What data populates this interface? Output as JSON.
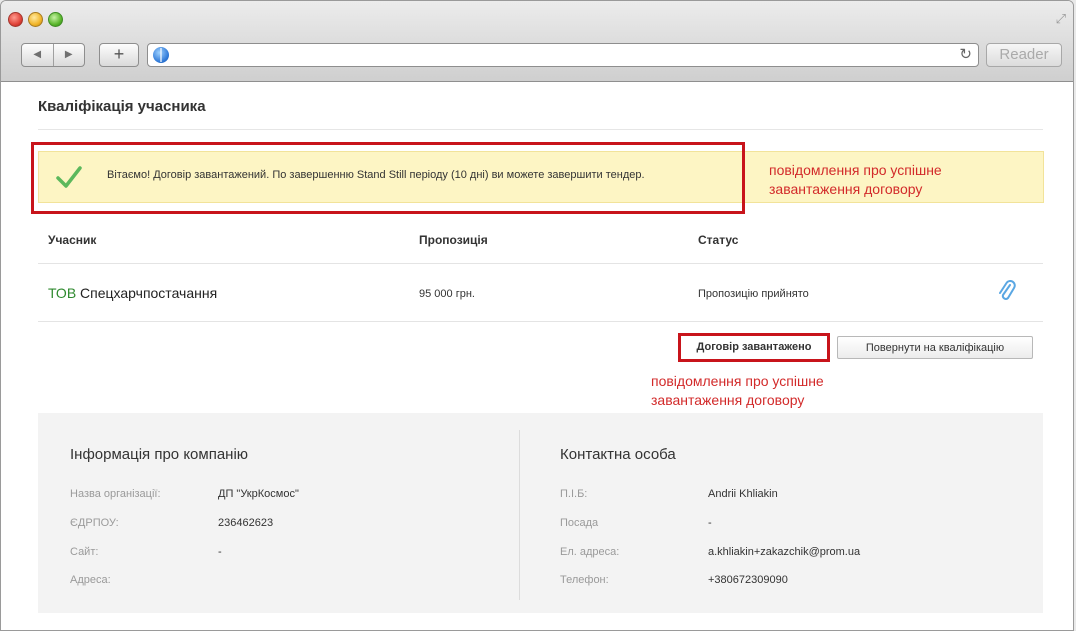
{
  "browser": {
    "reader_label": "Reader",
    "back_glyph": "◀",
    "forward_glyph": "▶",
    "new_tab_glyph": "+",
    "reload_glyph": "↻",
    "resize_glyph": "⤢"
  },
  "page": {
    "title": "Кваліфікація учасника"
  },
  "alert": {
    "text": "Вітаємо! Договір завантажений. По завершенню Stand Still періоду (10 дні) ви можете завершити тендер.",
    "note": "повідомлення про успішне завантаження договору",
    "accent_color": "#5cb85c"
  },
  "table": {
    "headers": [
      "Учасник",
      "Пропозиція",
      "Статус"
    ],
    "row": {
      "prefix": "ТОВ",
      "company": "Спецхарчпостачання",
      "offer": "95 000 грн.",
      "status": "Пропозицію прийнято"
    }
  },
  "actions": {
    "loaded_label": "Договір завантажено",
    "return_label": "Повернути на кваліфікацію",
    "note": "повідомлення про успішне завантаження договору",
    "highlight_color": "#c8141b"
  },
  "company_info": {
    "title": "Інформація про компанію",
    "fields": [
      {
        "label": "Назва організації:",
        "value": "ДП \"УкрКосмос\""
      },
      {
        "label": "ЄДРПОУ:",
        "value": "236462623"
      },
      {
        "label": "Сайт:",
        "value": "-"
      },
      {
        "label": "Адреса:",
        "value": ""
      }
    ]
  },
  "contact": {
    "title": "Контактна особа",
    "fields": [
      {
        "label": "П.І.Б:",
        "value": "Andrii Khliakin"
      },
      {
        "label": "Посада",
        "value": "-"
      },
      {
        "label": "Ел. адреса:",
        "value": "a.khliakin+zakazchik@prom.ua"
      },
      {
        "label": "Телефон:",
        "value": "+380672309090"
      }
    ]
  }
}
